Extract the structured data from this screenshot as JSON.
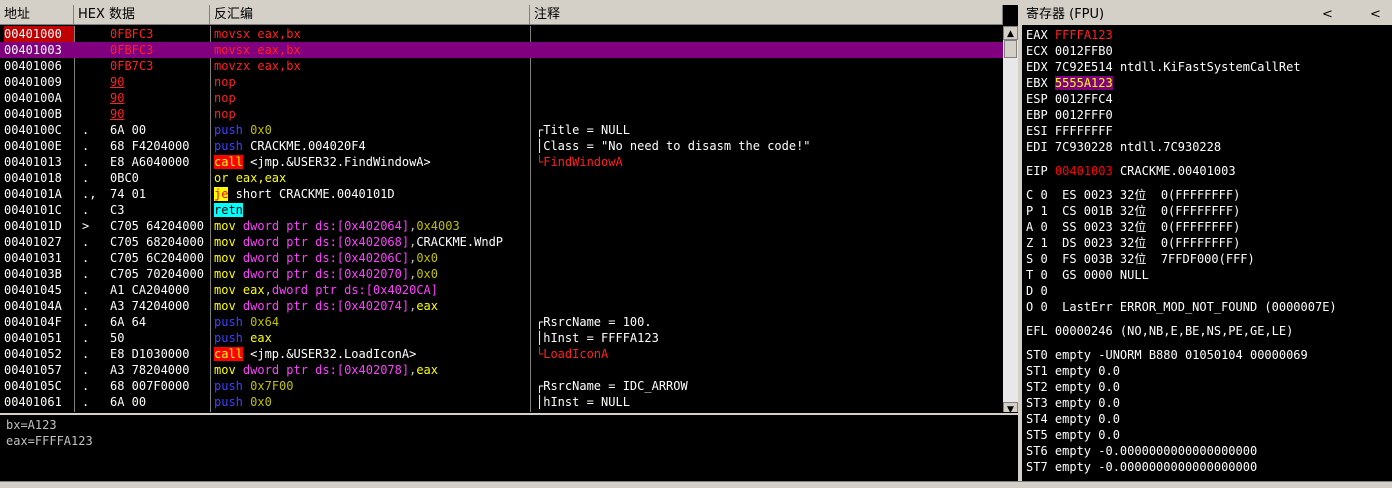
{
  "cpu_headers": {
    "addr": "地址",
    "hex": "HEX 数据",
    "disasm": "反汇编",
    "comment": "注释"
  },
  "rows": [
    {
      "addr": "00401000",
      "mark": "",
      "hex": "0FBFC3",
      "dis": "movsx eax,bx",
      "cmt": ""
    },
    {
      "addr": "00401003",
      "mark": "",
      "hex": "0FBFC3",
      "dis": "movsx eax,bx",
      "cmt": ""
    },
    {
      "addr": "00401006",
      "mark": "",
      "hex": "0FB7C3",
      "dis": "movzx eax,bx",
      "cmt": ""
    },
    {
      "addr": "00401009",
      "mark": "",
      "hex": "90",
      "dis": "nop",
      "cmt": ""
    },
    {
      "addr": "0040100A",
      "mark": "",
      "hex": "90",
      "dis": "nop",
      "cmt": ""
    },
    {
      "addr": "0040100B",
      "mark": "",
      "hex": "90",
      "dis": "nop",
      "cmt": ""
    },
    {
      "addr": "0040100C",
      "mark": ".",
      "hex": "6A 00",
      "dis": "push 0x0",
      "cmt": "┌Title = NULL"
    },
    {
      "addr": "0040100E",
      "mark": ".",
      "hex": "68 F4204000",
      "dis": "push CRACKME.004020F4",
      "cmt": "│Class = \"No need to disasm the code!\""
    },
    {
      "addr": "00401013",
      "mark": ".",
      "hex": "E8 A6040000",
      "dis": "call <jmp.&USER32.FindWindowA>",
      "cmt": "└FindWindowA"
    },
    {
      "addr": "00401018",
      "mark": ".",
      "hex": "0BC0",
      "dis": "or eax,eax",
      "cmt": ""
    },
    {
      "addr": "0040101A",
      "mark": ".,",
      "hex": "74 01",
      "dis": "je short CRACKME.0040101D",
      "cmt": ""
    },
    {
      "addr": "0040101C",
      "mark": ".",
      "hex": "C3",
      "dis": "retn",
      "cmt": ""
    },
    {
      "addr": "0040101D",
      "mark": ">",
      "hex": "C705 64204000",
      "dis": "mov dword ptr ds:[0x402064],0x4003",
      "cmt": ""
    },
    {
      "addr": "00401027",
      "mark": ".",
      "hex": "C705 68204000",
      "dis": "mov dword ptr ds:[0x402068],CRACKME.WndP",
      "cmt": ""
    },
    {
      "addr": "00401031",
      "mark": ".",
      "hex": "C705 6C204000",
      "dis": "mov dword ptr ds:[0x40206C],0x0",
      "cmt": ""
    },
    {
      "addr": "0040103B",
      "mark": ".",
      "hex": "C705 70204000",
      "dis": "mov dword ptr ds:[0x402070],0x0",
      "cmt": ""
    },
    {
      "addr": "00401045",
      "mark": ".",
      "hex": "A1 CA204000",
      "dis": "mov eax,dword ptr ds:[0x4020CA]",
      "cmt": ""
    },
    {
      "addr": "0040104A",
      "mark": ".",
      "hex": "A3 74204000",
      "dis": "mov dword ptr ds:[0x402074],eax",
      "cmt": ""
    },
    {
      "addr": "0040104F",
      "mark": ".",
      "hex": "6A 64",
      "dis": "push 0x64",
      "cmt": "┌RsrcName = 100."
    },
    {
      "addr": "00401051",
      "mark": ".",
      "hex": "50",
      "dis": "push eax",
      "cmt": "│hInst = FFFFA123"
    },
    {
      "addr": "00401052",
      "mark": ".",
      "hex": "E8 D1030000",
      "dis": "call <jmp.&USER32.LoadIconA>",
      "cmt": "└LoadIconA"
    },
    {
      "addr": "00401057",
      "mark": ".",
      "hex": "A3 78204000",
      "dis": "mov dword ptr ds:[0x402078],eax",
      "cmt": ""
    },
    {
      "addr": "0040105C",
      "mark": ".",
      "hex": "68 007F0000",
      "dis": "push 0x7F00",
      "cmt": "┌RsrcName = IDC_ARROW"
    },
    {
      "addr": "00401061",
      "mark": ".",
      "hex": "6A 00",
      "dis": "push 0x0",
      "cmt": "│hInst = NULL"
    }
  ],
  "info_lines": [
    "bx=A123",
    "eax=FFFFA123"
  ],
  "reg_header": {
    "title": "寄存器 (FPU)",
    "prev": "<",
    "next": "<"
  },
  "registers": [
    {
      "name": "EAX",
      "value": "FFFFA123",
      "note": ""
    },
    {
      "name": "ECX",
      "value": "0012FFB0",
      "note": ""
    },
    {
      "name": "EDX",
      "value": "7C92E514",
      "note": "ntdll.KiFastSystemCallRet"
    },
    {
      "name": "EBX",
      "value": "5555A123",
      "note": ""
    },
    {
      "name": "ESP",
      "value": "0012FFC4",
      "note": ""
    },
    {
      "name": "EBP",
      "value": "0012FFF0",
      "note": ""
    },
    {
      "name": "ESI",
      "value": "FFFFFFFF",
      "note": ""
    },
    {
      "name": "EDI",
      "value": "7C930228",
      "note": "ntdll.7C930228"
    }
  ],
  "eip": {
    "name": "EIP",
    "value": "00401003",
    "note": "CRACKME.00401003"
  },
  "flags": [
    "C 0  ES 0023 32位  0(FFFFFFFF)",
    "P 1  CS 001B 32位  0(FFFFFFFF)",
    "A 0  SS 0023 32位  0(FFFFFFFF)",
    "Z 1  DS 0023 32位  0(FFFFFFFF)",
    "S 0  FS 003B 32位  7FFDF000(FFF)",
    "T 0  GS 0000 NULL",
    "D 0",
    "O 0  LastErr ERROR_MOD_NOT_FOUND (0000007E)"
  ],
  "efl": "EFL 00000246 (NO,NB,E,BE,NS,PE,GE,LE)",
  "fpu": [
    "ST0 empty -UNORM B880 01050104 00000069",
    "ST1 empty 0.0",
    "ST2 empty 0.0",
    "ST3 empty 0.0",
    "ST4 empty 0.0",
    "ST5 empty 0.0",
    "ST6 empty -0.0000000000000000000",
    "ST7 empty -0.0000000000000000000"
  ],
  "colors": {
    "selection": "#800080",
    "current_addr": "#c00000",
    "call_bg": "#ff0000",
    "je_bg": "#ffff00",
    "retn_bg": "#00ffff"
  }
}
